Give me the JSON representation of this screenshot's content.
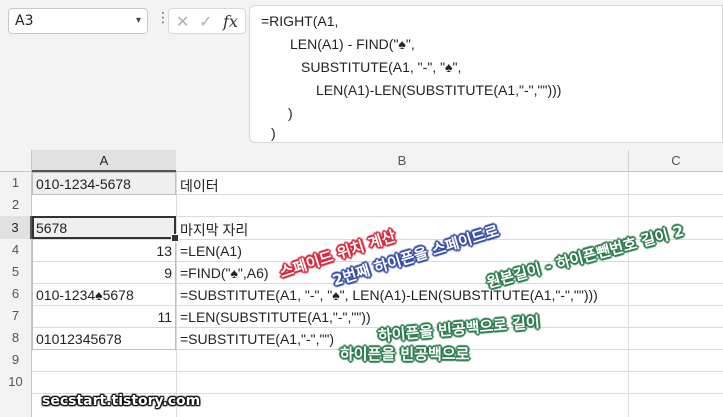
{
  "namebox": {
    "value": "A3",
    "dropdown_icon": "chevron-down-icon"
  },
  "formula_bar": {
    "menu_icon": "vertical-ellipsis-icon",
    "cancel_icon": "x-icon",
    "enter_icon": "checkmark-icon",
    "fx_label": "fx",
    "lines": [
      "=RIGHT(A1,",
      "LEN(A1) - FIND(\"♠\",",
      "SUBSTITUTE(A1, \"-\", \"♠\",",
      "LEN(A1)-LEN(SUBSTITUTE(A1,\"-\",\"\")))",
      ")",
      ")"
    ]
  },
  "columns": [
    "A",
    "B",
    "C"
  ],
  "rows": [
    "1",
    "2",
    "3",
    "4",
    "5",
    "6",
    "7",
    "8",
    "9",
    "10"
  ],
  "cells": {
    "A1": "010-1234-5678",
    "B1": "데이터",
    "A3": "5678",
    "B3": "마지막 자리",
    "A4": "13",
    "B4": "=LEN(A1)",
    "A5": "9",
    "B5": "=FIND(\"♠\",A6)",
    "A6": "010-1234♠5678",
    "B6": "=SUBSTITUTE(A1, \"-\", \"♠\", LEN(A1)-LEN(SUBSTITUTE(A1,\"-\",\"\")))",
    "A7": "11",
    "B7": "=LEN(SUBSTITUTE(A1,\"-\",\"\"))",
    "A8": "01012345678",
    "B8": "=SUBSTITUTE(A1,\"-\",\"\")"
  },
  "annotations": {
    "spade_position": "스페이드 위치 계산",
    "second_hyphen": "2번째 하이픈을 스페이드로",
    "length_diff": "원본길이 - 하이픈뺀번호 길이 2",
    "hyphen_blank_length": "하이픈을 빈공백으로 길이",
    "hyphen_blank": "하이픈을 빈공백으로"
  },
  "colors": {
    "spade_position": "#d8283a",
    "second_hyphen": "#3b4fa8",
    "length_diff": "#2e7d4f",
    "hyphen_blank_length": "#2e7d4f",
    "hyphen_blank": "#2e7d4f"
  },
  "watermark": "secstart.tistory.com"
}
